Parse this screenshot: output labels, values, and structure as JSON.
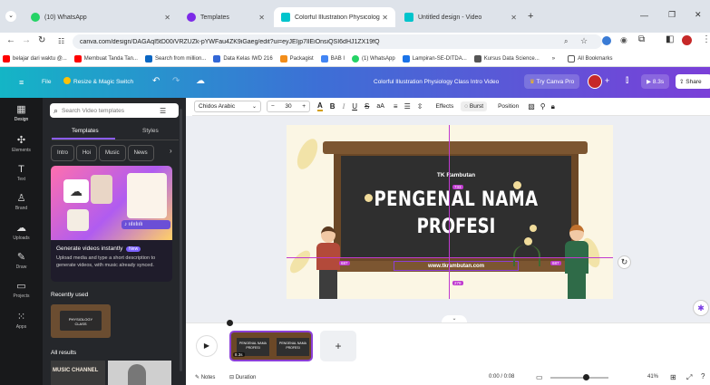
{
  "browser": {
    "tabs": [
      {
        "label": "(10) WhatsApp",
        "color": "#25d366"
      },
      {
        "label": "Templates",
        "color": "#7d2ae8"
      },
      {
        "label": "Colorful Illustration Physicolog",
        "color": "#00c4cc"
      },
      {
        "label": "Untitled design - Video",
        "color": "#00c4cc"
      }
    ],
    "url": "canva.com/design/DAGAqI5tD00/VRZUZk-pYWFau4ZK9iGaeg/edit?ui=eyJEIjp7IlEiOnsiQSI6dHJ1ZX19fQ",
    "bookmarks": [
      {
        "label": "belajar dari waktu @...",
        "color": "#ff0000"
      },
      {
        "label": "Membuat Tanda Tan...",
        "color": "#ff0000"
      },
      {
        "label": "Search from million...",
        "color": "#0a66c2"
      },
      {
        "label": "Data Kelas IWD 216",
        "color": "#3367d6"
      },
      {
        "label": "Packagist",
        "color": "#f28d1a"
      },
      {
        "label": "BAB I",
        "color": "#4285f4"
      },
      {
        "label": "(1) WhatsApp",
        "color": "#25d366"
      },
      {
        "label": "Lampiran-SE-DITDA...",
        "color": "#1a73e8"
      },
      {
        "label": "Kursus Data Science...",
        "color": "#555555"
      }
    ],
    "all_bookmarks": "All Bookmarks",
    "more": "»"
  },
  "header": {
    "file": "File",
    "resize": "Resize & Magic Switch",
    "title": "Colorful Illustration Physiology Class Intro Video",
    "try_pro": "Try Canva Pro",
    "time": "8.3s",
    "share": "Share"
  },
  "sidenav": {
    "items": [
      {
        "label": "Design",
        "icon": "▦"
      },
      {
        "label": "Elements",
        "icon": "✣"
      },
      {
        "label": "Text",
        "icon": "T"
      },
      {
        "label": "Brand",
        "icon": "♙"
      },
      {
        "label": "Uploads",
        "icon": "☁"
      },
      {
        "label": "Draw",
        "icon": "✎"
      },
      {
        "label": "Projects",
        "icon": "▭"
      },
      {
        "label": "Apps",
        "icon": "⁙"
      }
    ]
  },
  "panel": {
    "search_placeholder": "Search Video templates",
    "tabs": [
      "Templates",
      "Styles"
    ],
    "chips": [
      "Intro",
      "Hoi",
      "Music",
      "News"
    ],
    "promo": {
      "title": "Generate videos instantly",
      "badge": "New",
      "desc": "Upload media and type a short description to generate videos, with music already synced."
    },
    "recently_used": "Recently used",
    "recent_thumb_text": "PHYSIOLOGY CLASS",
    "all_results": "All results",
    "result_thumb_text": "MUSIC CHANNEL"
  },
  "toolbar": {
    "font": "Chidos Arabic",
    "size": "30",
    "effects": "Effects",
    "burst": "Burst",
    "position": "Position"
  },
  "canvas": {
    "school": "TK Rambutan",
    "line1": "PENGENAL NAMA",
    "line2": "PROFESI",
    "website": "www.tkrambutan.com",
    "dim_w": "733",
    "dim_h": "278",
    "left_badge": "687",
    "right_badge": "687"
  },
  "timeline": {
    "page_duration": "8.3s",
    "thumb_text1": "PENGENAL NAMA",
    "thumb_text2": "PROFESI",
    "add": "+"
  },
  "footer": {
    "notes": "Notes",
    "duration": "Duration",
    "time": "0:00 / 0:08",
    "zoom": "41%",
    "progress": 0.62
  }
}
